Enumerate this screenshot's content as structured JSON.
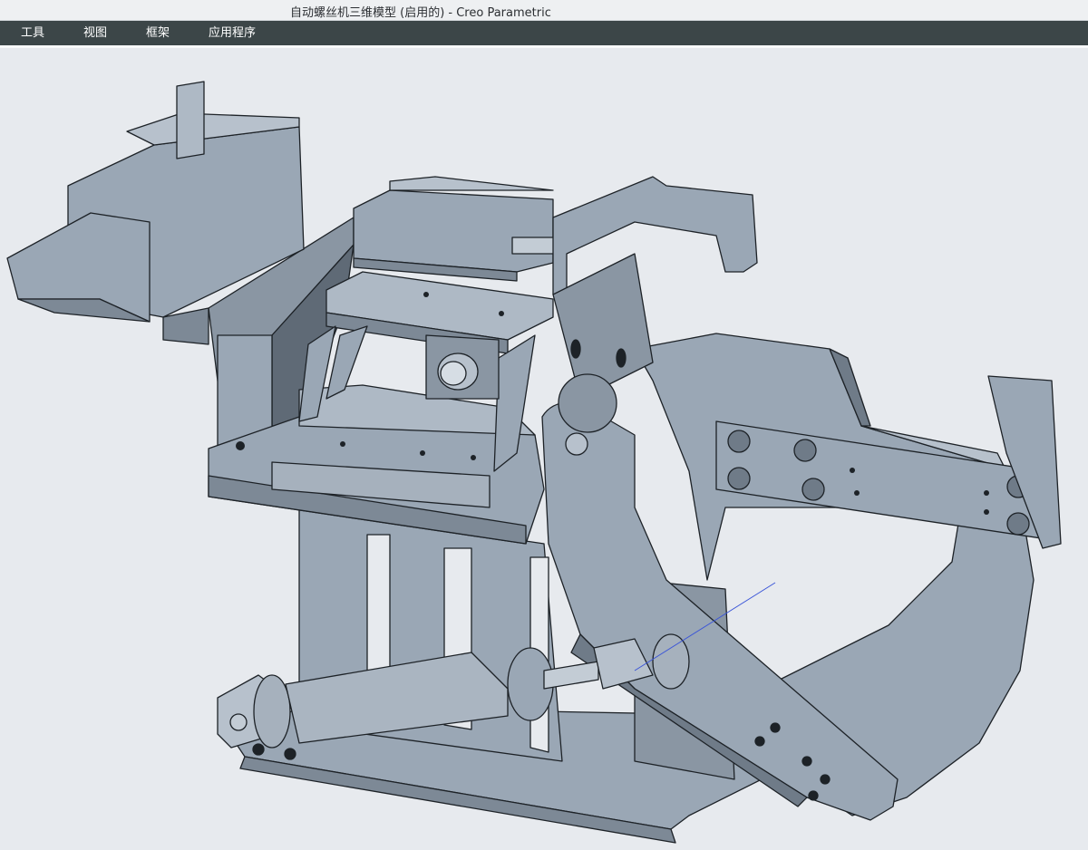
{
  "window": {
    "title": "自动螺丝机三维模型 (启用的) - Creo Parametric"
  },
  "menu": {
    "items": [
      {
        "key": "tools",
        "label": "工具"
      },
      {
        "key": "view",
        "label": "视图"
      },
      {
        "key": "frame",
        "label": "框架"
      },
      {
        "key": "applications",
        "label": "应用程序"
      }
    ]
  },
  "viewport": {
    "model_color": "#9aa7b5",
    "model_dark_color": "#6f7b88",
    "edge_color": "#1d2227",
    "background_color": "#e7eaee",
    "axis_color": "#3a55d8"
  }
}
